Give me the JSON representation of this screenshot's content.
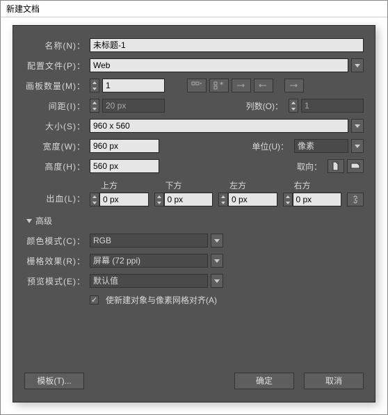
{
  "title": "新建文档",
  "labels": {
    "name": "名称(N)：",
    "profile": "配置文件(P)：",
    "artboards": "画板数量(M)：",
    "spacing": "间距(I)：",
    "columns": "列数(O)：",
    "size": "大小(S)：",
    "width": "宽度(W)：",
    "height": "高度(H)：",
    "units": "单位(U)：",
    "orientation": "取向：",
    "bleed": "出血(L)：",
    "top": "上方",
    "bottom": "下方",
    "left": "左方",
    "right": "右方",
    "advanced": "高级",
    "colorMode": "颜色模式(C)：",
    "raster": "栅格效果(R)：",
    "preview": "预览模式(E)：",
    "align": "使新建对象与像素网格对齐(A)",
    "templates": "模板(T)...",
    "ok": "确定",
    "cancel": "取消"
  },
  "values": {
    "name": "未标题-1",
    "profile": "Web",
    "artboards": "1",
    "spacing": "20 px",
    "columns": "1",
    "size": "960 x 560",
    "width": "960 px",
    "height": "560 px",
    "units": "像素",
    "bleedTop": "0 px",
    "bleedBottom": "0 px",
    "bleedLeft": "0 px",
    "bleedRight": "0 px",
    "colorMode": "RGB",
    "raster": "屏幕 (72 ppi)",
    "preview": "默认值",
    "alignChecked": "✓"
  }
}
